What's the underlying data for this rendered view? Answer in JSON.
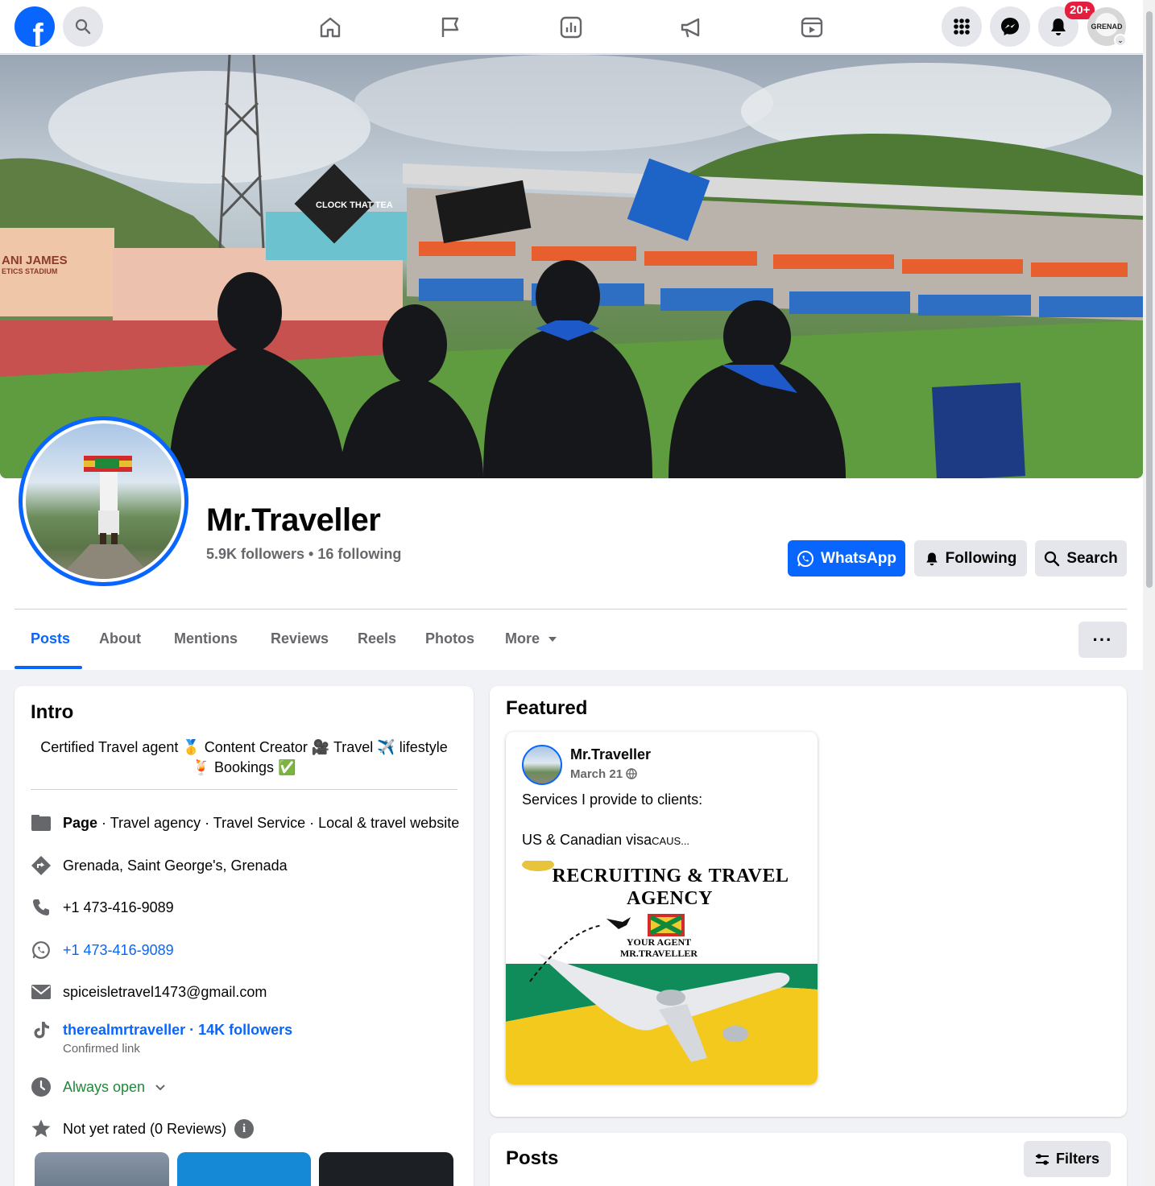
{
  "topbar": {
    "badge": "20+",
    "account_badge_text": "GRENAD"
  },
  "profile": {
    "name": "Mr.Traveller",
    "followers_info": "5.9K followers • 16 following",
    "buttons": {
      "whatsapp": "WhatsApp",
      "following": "Following",
      "search": "Search"
    }
  },
  "cover": {
    "stadium_sign_line1": "ANI  JAMES",
    "stadium_sign_line2": "ETICS     STADIUM",
    "cap_text": "CLOCK THAT TEA"
  },
  "tabs": [
    {
      "label": "Posts",
      "active": true
    },
    {
      "label": "About"
    },
    {
      "label": "Mentions"
    },
    {
      "label": "Reviews"
    },
    {
      "label": "Reels"
    },
    {
      "label": "Photos"
    },
    {
      "label": "More"
    }
  ],
  "intro": {
    "title": "Intro",
    "bio_line1": "Certified Travel agent 🥇 Content Creator 🎥 Travel ✈️ lifestyle",
    "bio_line2": "🍹 Bookings ✅",
    "page_label": "Page",
    "categories": " · Travel agency · Travel Service · Local & travel website",
    "location": "Grenada, Saint George's, Grenada",
    "phone": "+1 473-416-9089",
    "whatsapp": "+1 473-416-9089",
    "email": "spiceisletravel1473@gmail.com",
    "tiktok": "therealmrtraveller · 14K followers",
    "tiktok_sub": "Confirmed link",
    "hours": "Always open",
    "rating": "Not yet rated (0 Reviews)"
  },
  "featured": {
    "title": "Featured",
    "post": {
      "author": "Mr.Traveller",
      "date": "March 21",
      "line1": "Services I provide to clients:",
      "line2": "US & Canadian visa",
      "line2_small": "CAUS...",
      "image_line1": "RECRUITING & TRAVEL",
      "image_line2": "AGENCY",
      "image_line3": "YOUR AGENT",
      "image_line4": "MR.TRAVELLER"
    }
  },
  "posts": {
    "title": "Posts",
    "filters_label": "Filters"
  },
  "colors": {
    "brand_blue": "#0866ff",
    "badge_red": "#e41e3f",
    "open_green": "#20883b"
  }
}
